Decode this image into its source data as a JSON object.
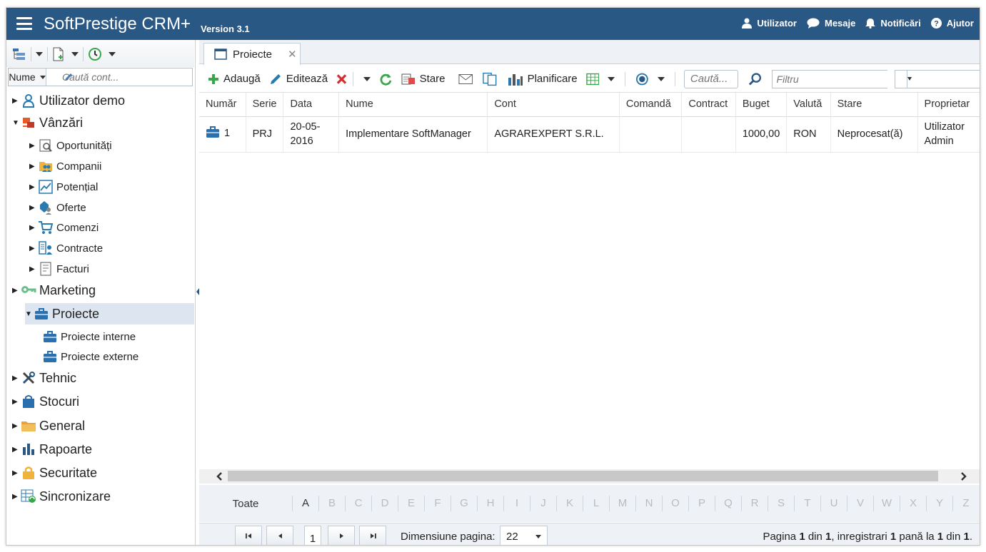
{
  "header": {
    "app_title": "SoftPrestige CRM+",
    "version": "Version 3.1",
    "menu": [
      {
        "label": "Utilizator",
        "icon": "user-icon"
      },
      {
        "label": "Mesaje",
        "icon": "chat-icon"
      },
      {
        "label": "Notificări",
        "icon": "bell-icon"
      },
      {
        "label": "Ajutor",
        "icon": "help-icon"
      }
    ]
  },
  "sidebar": {
    "search": {
      "field": "Nume",
      "placeholder": "Caută cont..."
    },
    "tree": [
      {
        "label": "Utilizator demo",
        "icon": "user-outline-icon",
        "arrow": "▶"
      },
      {
        "label": "Vânzări",
        "icon": "sales-icon",
        "arrow": "▼"
      },
      {
        "label": "Oportunități",
        "icon": "opportunity-icon",
        "arrow": "▶"
      },
      {
        "label": "Companii",
        "icon": "companies-icon",
        "arrow": "▶"
      },
      {
        "label": "Potențial",
        "icon": "chart-line-icon",
        "arrow": "▶"
      },
      {
        "label": "Oferte",
        "icon": "offers-icon",
        "arrow": "▶"
      },
      {
        "label": "Comenzi",
        "icon": "cart-icon",
        "arrow": "▶"
      },
      {
        "label": "Contracte",
        "icon": "contract-icon",
        "arrow": "▶"
      },
      {
        "label": "Facturi",
        "icon": "invoice-icon",
        "arrow": "▶"
      },
      {
        "label": "Marketing",
        "icon": "keys-icon",
        "arrow": "▶"
      },
      {
        "label": "Proiecte",
        "icon": "briefcase-icon",
        "arrow": "▼"
      },
      {
        "label": "Proiecte interne",
        "icon": "briefcase-icon",
        "arrow": ""
      },
      {
        "label": "Proiecte externe",
        "icon": "briefcase-icon",
        "arrow": ""
      },
      {
        "label": "Tehnic",
        "icon": "tools-icon",
        "arrow": "▶"
      },
      {
        "label": "Stocuri",
        "icon": "bag-icon",
        "arrow": "▶"
      },
      {
        "label": "General",
        "icon": "folder-icon",
        "arrow": "▶"
      },
      {
        "label": "Rapoarte",
        "icon": "bar-chart-icon",
        "arrow": "▶"
      },
      {
        "label": "Securitate",
        "icon": "lock-icon",
        "arrow": "▶"
      },
      {
        "label": "Sincronizare",
        "icon": "sync-table-icon",
        "arrow": "▶"
      }
    ]
  },
  "tab": {
    "label": "Proiecte",
    "close": "✕"
  },
  "toolbar": {
    "add": "Adaugă",
    "edit": "Editează",
    "status": "Stare",
    "planning": "Planificare",
    "search_placeholder": "Caută...",
    "filter_placeholder": "Filtru"
  },
  "grid": {
    "columns": [
      "Număr",
      "Serie",
      "Data",
      "Nume",
      "Cont",
      "Comandă",
      "Contract",
      "Buget",
      "Valută",
      "Stare",
      "Proprietar"
    ],
    "rows": [
      [
        "1",
        "PRJ",
        "20-05-2016",
        "Implementare SoftManager",
        "AGRAREXPERT S.R.L.",
        "",
        "",
        "1000,00",
        "RON",
        "Neprocesat(ă)",
        "Utilizator Admin"
      ]
    ]
  },
  "alphabet": {
    "all": "Toate",
    "letters": [
      "A",
      "B",
      "C",
      "D",
      "E",
      "F",
      "G",
      "H",
      "I",
      "J",
      "K",
      "L",
      "M",
      "N",
      "O",
      "P",
      "Q",
      "R",
      "S",
      "T",
      "U",
      "V",
      "W",
      "X",
      "Y",
      "Z"
    ],
    "active": "A"
  },
  "pager": {
    "page": "1",
    "page_size_label": "Dimensiune pagina:",
    "page_size": "22",
    "info": {
      "prefix": "Pagina ",
      "page": "1",
      "din1": " din ",
      "total_pages": "1",
      "mid": ", inregistrari ",
      "from": "1",
      "pana": " pană la ",
      "to": "1",
      "din2": " din ",
      "total": "1",
      "end": "."
    }
  },
  "colors": {
    "header_bg": "#2a5885",
    "accent": "#2a7ab0",
    "add_green": "#3aa64b",
    "delete_red": "#d32f2f"
  }
}
